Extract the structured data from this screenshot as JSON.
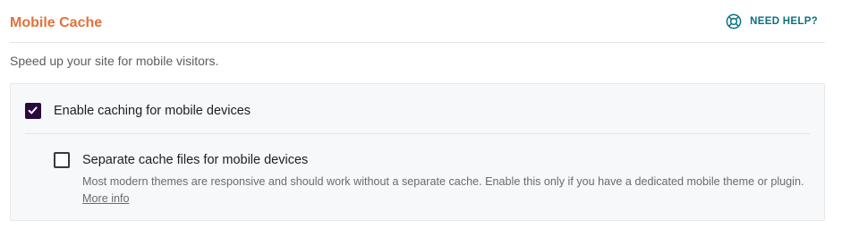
{
  "header": {
    "title": "Mobile Cache",
    "help_label": "NEED HELP?",
    "help_icon": "lifebuoy-icon",
    "title_color": "#e2713d",
    "help_color": "#0d7180"
  },
  "description": "Speed up your site for mobile visitors.",
  "options": {
    "enable_mobile": {
      "label": "Enable caching for mobile devices",
      "checked": true
    },
    "separate_files": {
      "label": "Separate cache files for mobile devices",
      "checked": false,
      "help_text": "Most modern themes are responsive and should work without a separate cache. Enable this only if you have a dedicated mobile theme or plugin.",
      "more_info_label": "More info"
    }
  },
  "colors": {
    "checkbox_checked": "#2a0a3d",
    "panel_background": "#f7f8f9"
  }
}
